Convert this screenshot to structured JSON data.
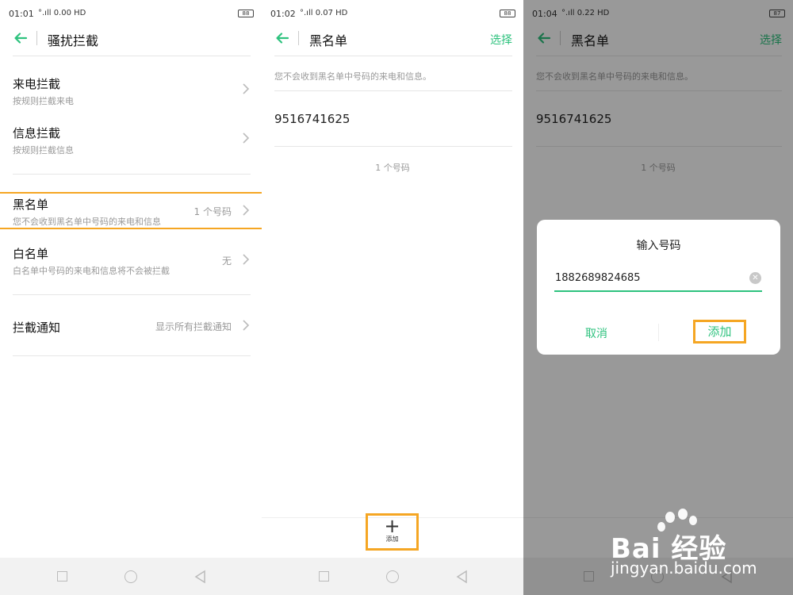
{
  "colors": {
    "accent": "#2ec27e",
    "highlight": "#f5a623"
  },
  "panel1": {
    "status": {
      "time": "01:01",
      "signal": "°.ıll 0.00 HD",
      "battery": "88"
    },
    "title": "骚扰拦截",
    "rows": [
      {
        "title": "来电拦截",
        "sub": "按规则拦截来电",
        "value": ""
      },
      {
        "title": "信息拦截",
        "sub": "按规则拦截信息",
        "value": ""
      },
      {
        "title": "黑名单",
        "sub": "您不会收到黑名单中号码的来电和信息",
        "value": "1 个号码"
      },
      {
        "title": "白名单",
        "sub": "白名单中号码的来电和信息将不会被拦截",
        "value": "无"
      },
      {
        "title": "拦截通知",
        "sub": "",
        "value": "显示所有拦截通知"
      }
    ]
  },
  "panel2": {
    "status": {
      "time": "01:02",
      "signal": "°.ıll 0.07 HD",
      "battery": "88"
    },
    "title": "黑名单",
    "action": "选择",
    "description": "您不会收到黑名单中号码的来电和信息。",
    "numbers": [
      "9516741625"
    ],
    "count": "1 个号码",
    "add_label": "添加",
    "add_icon": "plus-icon"
  },
  "panel3": {
    "status": {
      "time": "01:04",
      "signal": "°.ıll 0.22 HD",
      "battery": "87"
    },
    "title": "黑名单",
    "action": "选择",
    "description": "您不会收到黑名单中号码的来电和信息。",
    "numbers": [
      "9516741625"
    ],
    "count": "1 个号码",
    "dialog": {
      "title": "输入号码",
      "input_value": "1882689824685",
      "cancel": "取消",
      "confirm": "添加"
    }
  },
  "watermark": {
    "brand": "Bai 经验",
    "site": "jingyan.baidu.com"
  }
}
